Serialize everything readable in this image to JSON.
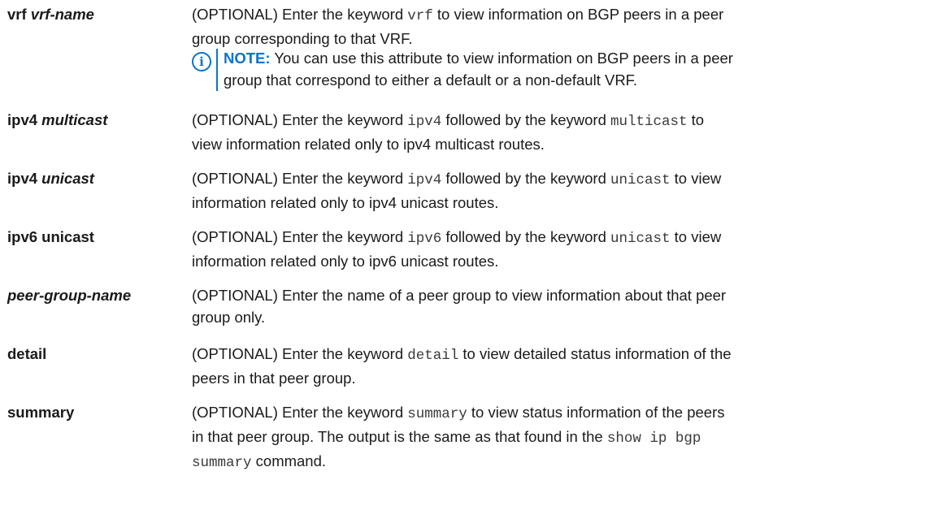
{
  "rows": {
    "vrf": {
      "term": "vrf",
      "term_it": "vrf-name",
      "d1": "(OPTIONAL) Enter the keyword ",
      "m1": "vrf",
      "d2": " to view information on BGP peers in a peer",
      "d3": "group corresponding to that VRF."
    },
    "note": {
      "label": "NOTE:",
      "l1": " You can use this attribute to view information on BGP peers in a peer",
      "l2": "group that correspond to either a default or a non-default VRF."
    },
    "ipv4m": {
      "term": "ipv4",
      "term_it": "multicast",
      "d1": "(OPTIONAL) Enter the keyword ",
      "m1": "ipv4",
      "d2": " followed by the keyword ",
      "m2": "multicast",
      "d3": " to",
      "d4": "view information related only to ipv4 multicast routes."
    },
    "ipv4u": {
      "term": "ipv4",
      "term_it": "unicast",
      "d1": "(OPTIONAL) Enter the keyword ",
      "m1": "ipv4",
      "d2": " followed by the keyword ",
      "m2": "unicast",
      "d3": " to view",
      "d4": "information related only to ipv4 unicast routes."
    },
    "ipv6u": {
      "term": "ipv6 unicast",
      "d1": "(OPTIONAL) Enter the keyword ",
      "m1": "ipv6",
      "d2": " followed by the keyword ",
      "m2": "unicast",
      "d3": " to view",
      "d4": "information related only to ipv6 unicast routes."
    },
    "pgn": {
      "term_it": "peer-group-name",
      "d1": "(OPTIONAL) Enter the name of a peer group to view information about that peer",
      "d2": "group only."
    },
    "detail": {
      "term": "detail",
      "d1": "(OPTIONAL) Enter the keyword ",
      "m1": "detail",
      "d2": " to view detailed status information of the",
      "d3": "peers in that peer group."
    },
    "summary": {
      "term": "summary",
      "d1": "(OPTIONAL) Enter the keyword ",
      "m1": "summary",
      "d2": " to view status information of the peers",
      "d3": "in that peer group. The output is the same as that found in the ",
      "m2": "show ip bgp",
      "m3": "summary",
      "d4": " command."
    }
  },
  "colors": {
    "accent": "#0a74c9",
    "text": "#1a1a1a"
  },
  "icons": {
    "note": "info-icon"
  }
}
